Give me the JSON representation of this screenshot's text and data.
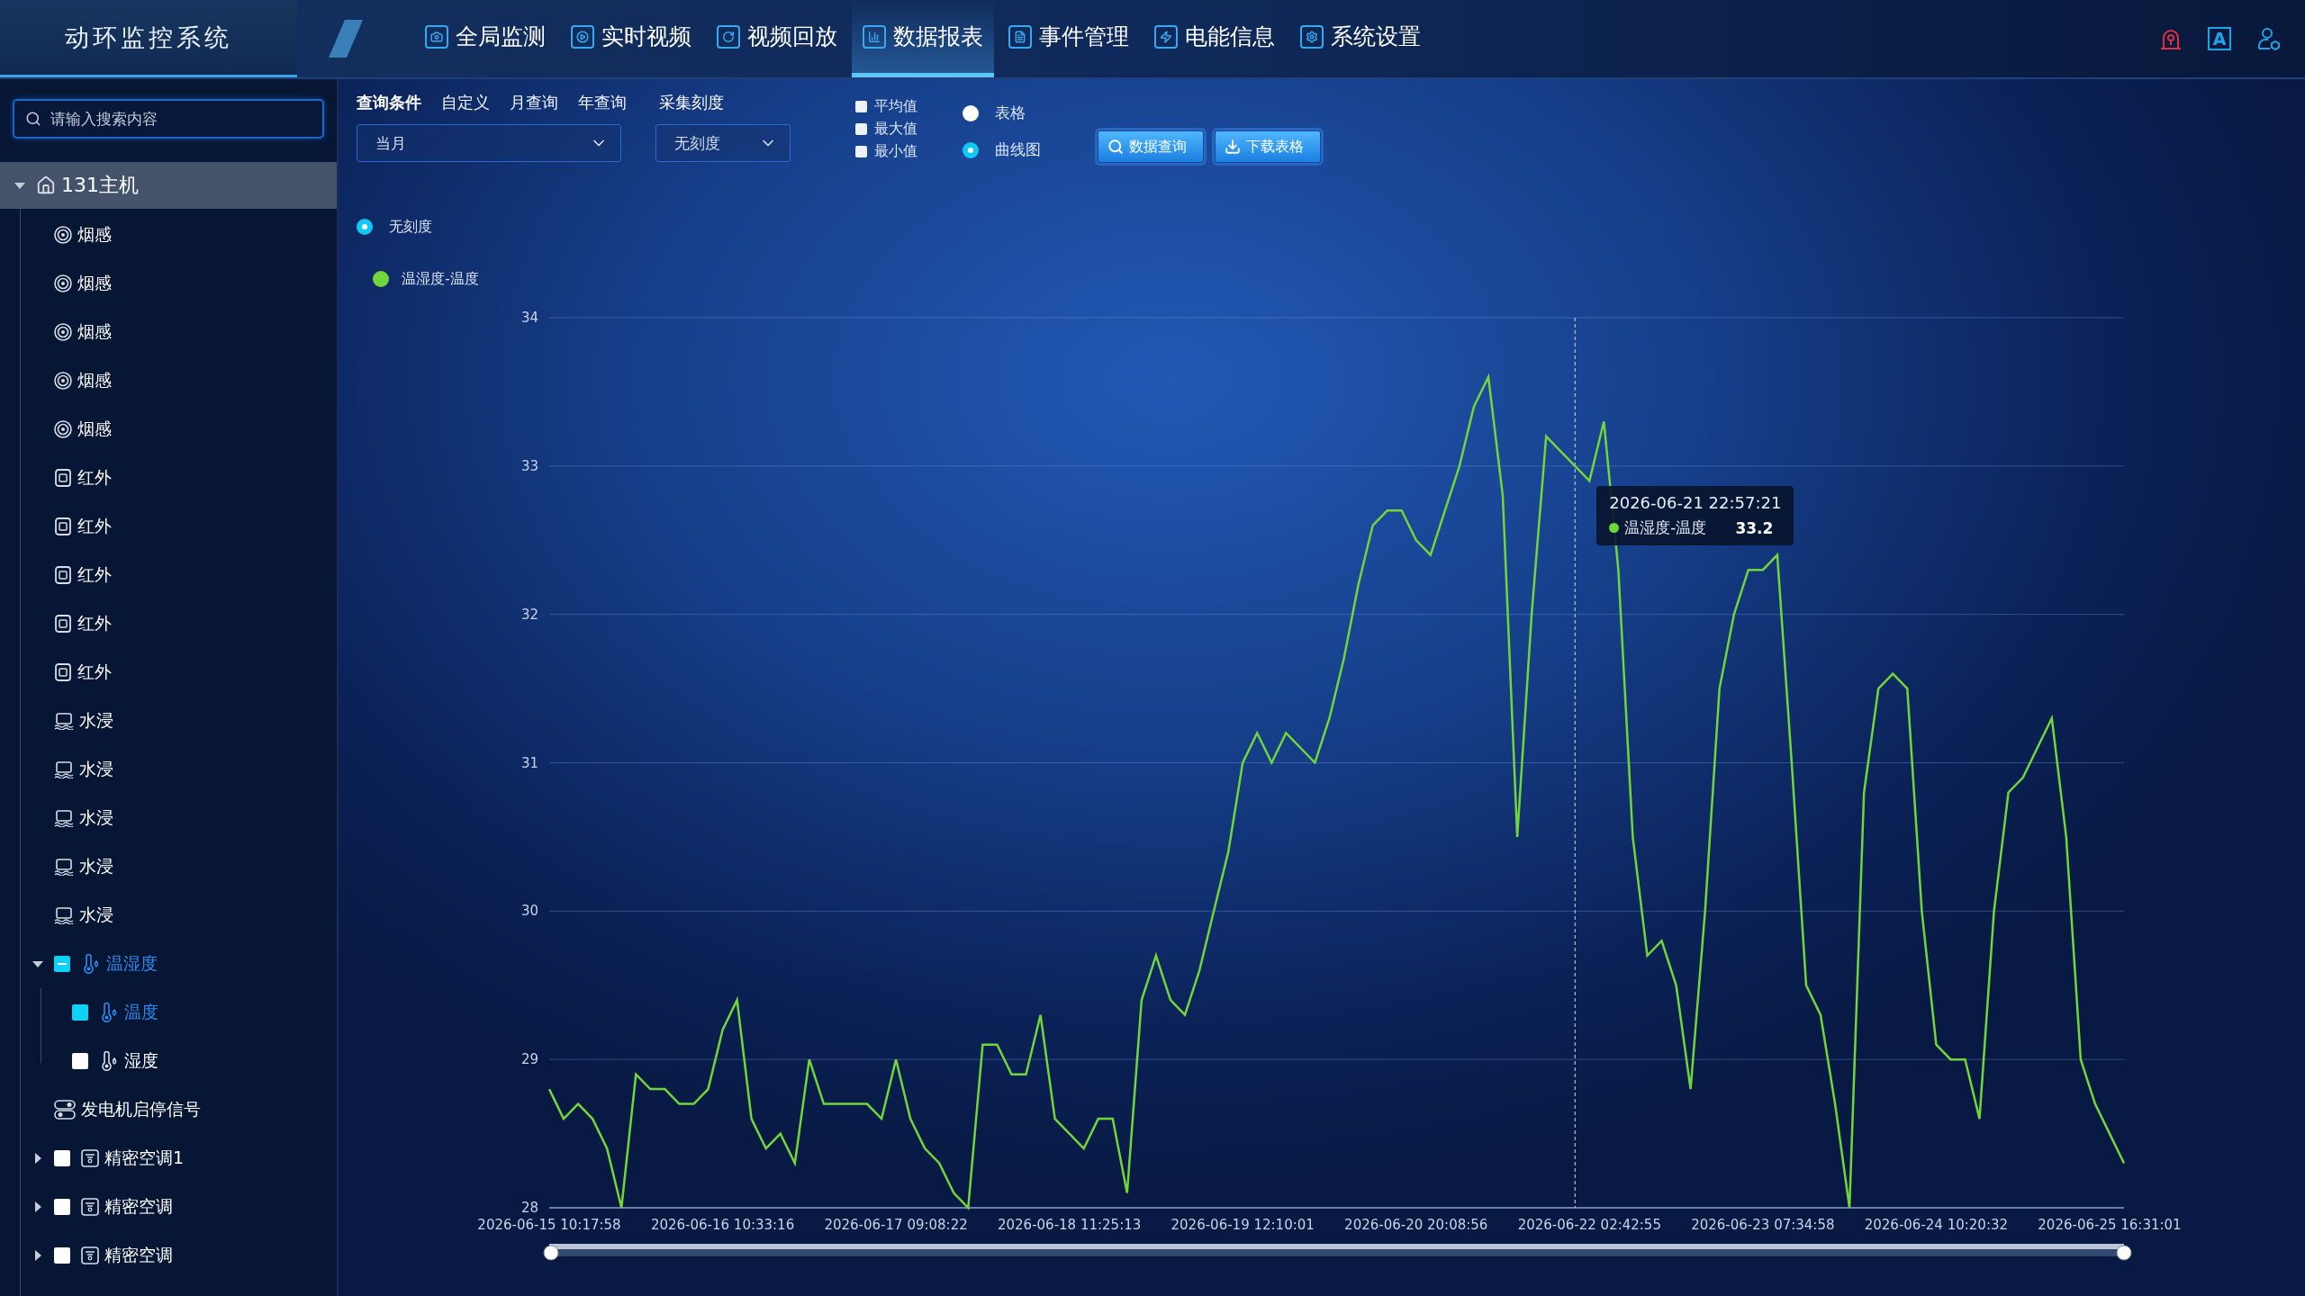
{
  "header": {
    "title": "动环监控系统",
    "nav": [
      {
        "label": "全局监测",
        "selected": false
      },
      {
        "label": "实时视频",
        "selected": false
      },
      {
        "label": "视频回放",
        "selected": false
      },
      {
        "label": "数据报表",
        "selected": true
      },
      {
        "label": "事件管理",
        "selected": false
      },
      {
        "label": "电能信息",
        "selected": false
      },
      {
        "label": "系统设置",
        "selected": false
      }
    ],
    "font_button": {
      "label": "A"
    }
  },
  "sidebar": {
    "search": {
      "placeholder": "请输入搜索内容"
    },
    "tree": [
      {
        "label": "131主机",
        "kind": "host",
        "expanded": true,
        "children": [
          {
            "label": "烟感",
            "kind": "smoke"
          },
          {
            "label": "烟感",
            "kind": "smoke"
          },
          {
            "label": "烟感",
            "kind": "smoke"
          },
          {
            "label": "烟感",
            "kind": "smoke"
          },
          {
            "label": "烟感",
            "kind": "smoke"
          },
          {
            "label": "红外",
            "kind": "infrared"
          },
          {
            "label": "红外",
            "kind": "infrared"
          },
          {
            "label": "红外",
            "kind": "infrared"
          },
          {
            "label": "红外",
            "kind": "infrared"
          },
          {
            "label": "红外",
            "kind": "infrared"
          },
          {
            "label": "水浸",
            "kind": "water"
          },
          {
            "label": "水浸",
            "kind": "water"
          },
          {
            "label": "水浸",
            "kind": "water"
          },
          {
            "label": "水浸",
            "kind": "water"
          },
          {
            "label": "水浸",
            "kind": "water"
          },
          {
            "label": "温湿度",
            "kind": "thermo",
            "expanded": true,
            "indeterminate": true,
            "children": [
              {
                "label": "温度",
                "kind": "thermo",
                "checked": true,
                "indeterminate": false
              },
              {
                "label": "湿度",
                "kind": "thermo",
                "checked": false,
                "indeterminate": false
              }
            ]
          },
          {
            "label": "发电机启停信号",
            "kind": "switch"
          },
          {
            "label": "精密空调1",
            "kind": "aircon",
            "expanded": false,
            "checked": false,
            "indeterminate": false
          },
          {
            "label": "精密空调",
            "kind": "aircon",
            "expanded": false,
            "checked": false,
            "indeterminate": false
          },
          {
            "label": "精密空调",
            "kind": "aircon",
            "expanded": false,
            "checked": false,
            "indeterminate": false
          }
        ]
      }
    ]
  },
  "query": {
    "heading": "查询条件",
    "modes": [
      {
        "label": "自定义",
        "selected": false
      },
      {
        "label": "月查询",
        "selected": false
      },
      {
        "label": "年查询",
        "selected": false
      }
    ],
    "period": {
      "value": "当月"
    },
    "scale_label": "采集刻度",
    "scale": {
      "value": "无刻度"
    },
    "stats": [
      {
        "label": "平均值",
        "checked": false
      },
      {
        "label": "最大值",
        "checked": false
      },
      {
        "label": "最小值",
        "checked": false
      }
    ],
    "views": [
      {
        "label": "表格",
        "selected": false
      },
      {
        "label": "曲线图",
        "selected": true
      }
    ],
    "buttons": [
      {
        "label": "数据查询"
      },
      {
        "label": "下载表格"
      }
    ]
  },
  "scale_options": [
    {
      "label": "无刻度",
      "selected": true
    }
  ],
  "chart": {
    "tooltip": {
      "time": "2026-06-21 22:57:21",
      "series": "温湿度-温度",
      "value": "33.2"
    },
    "chart_data": {
      "type": "line",
      "categories": [
        "2026-06-15 10:17:58",
        null,
        null,
        null,
        null,
        null,
        null,
        null,
        null,
        null,
        null,
        null,
        "2026-06-16 10:33:16",
        null,
        null,
        null,
        null,
        null,
        null,
        null,
        null,
        null,
        null,
        null,
        "2026-06-17 09:08:22",
        null,
        null,
        null,
        null,
        null,
        null,
        null,
        null,
        null,
        null,
        null,
        "2026-06-18 11:25:13",
        null,
        null,
        null,
        null,
        null,
        null,
        null,
        null,
        null,
        null,
        null,
        "2026-06-19 12:10:01",
        null,
        null,
        null,
        null,
        null,
        null,
        null,
        null,
        null,
        null,
        null,
        "2026-06-20 20:08:56",
        null,
        null,
        null,
        null,
        null,
        null,
        null,
        null,
        null,
        null,
        null,
        "2026-06-22 02:42:55",
        null,
        null,
        null,
        null,
        null,
        null,
        null,
        null,
        null,
        null,
        null,
        "2026-06-23 07:34:58",
        null,
        null,
        null,
        null,
        null,
        null,
        null,
        null,
        null,
        null,
        null,
        "2026-06-24 10:20:32",
        null,
        null,
        null,
        null,
        null,
        null,
        null,
        null,
        null,
        null,
        null,
        "2026-06-25 16:31:01",
        null
      ],
      "grid": true,
      "ylim": [
        28,
        34
      ],
      "yticks": [
        28,
        29,
        30,
        31,
        32,
        33,
        34
      ],
      "series": [
        {
          "name": "温湿度-温度",
          "color": "#72d63a",
          "values": [
            28.8,
            28.6,
            28.7,
            28.6,
            28.4,
            28.0,
            28.9,
            28.8,
            28.8,
            28.7,
            28.7,
            28.8,
            29.2,
            29.4,
            28.6,
            28.4,
            28.5,
            28.3,
            29.0,
            28.7,
            28.7,
            28.7,
            28.7,
            28.6,
            29.0,
            28.6,
            28.4,
            28.3,
            28.1,
            28.0,
            29.1,
            29.1,
            28.9,
            28.9,
            29.3,
            28.6,
            28.5,
            28.4,
            28.6,
            28.6,
            28.1,
            29.4,
            29.7,
            29.4,
            29.3,
            29.6,
            30.0,
            30.4,
            31.0,
            31.2,
            31.0,
            31.2,
            31.1,
            31.0,
            31.3,
            31.7,
            32.2,
            32.6,
            32.7,
            32.7,
            32.5,
            32.4,
            32.7,
            33.0,
            33.4,
            33.6,
            32.8,
            30.5,
            32.0,
            33.2,
            33.1,
            33.0,
            32.9,
            33.3,
            32.3,
            30.5,
            29.7,
            29.8,
            29.5,
            28.8,
            30.0,
            31.5,
            32.0,
            32.3,
            32.3,
            32.4,
            31.0,
            29.5,
            29.3,
            28.7,
            28.0,
            30.8,
            31.5,
            31.6,
            31.5,
            30.0,
            29.1,
            29.0,
            29.0,
            28.6,
            30.0,
            30.8,
            30.9,
            31.1,
            31.3,
            30.5,
            29.0,
            28.7,
            28.5,
            28.3
          ]
        }
      ]
    }
  }
}
